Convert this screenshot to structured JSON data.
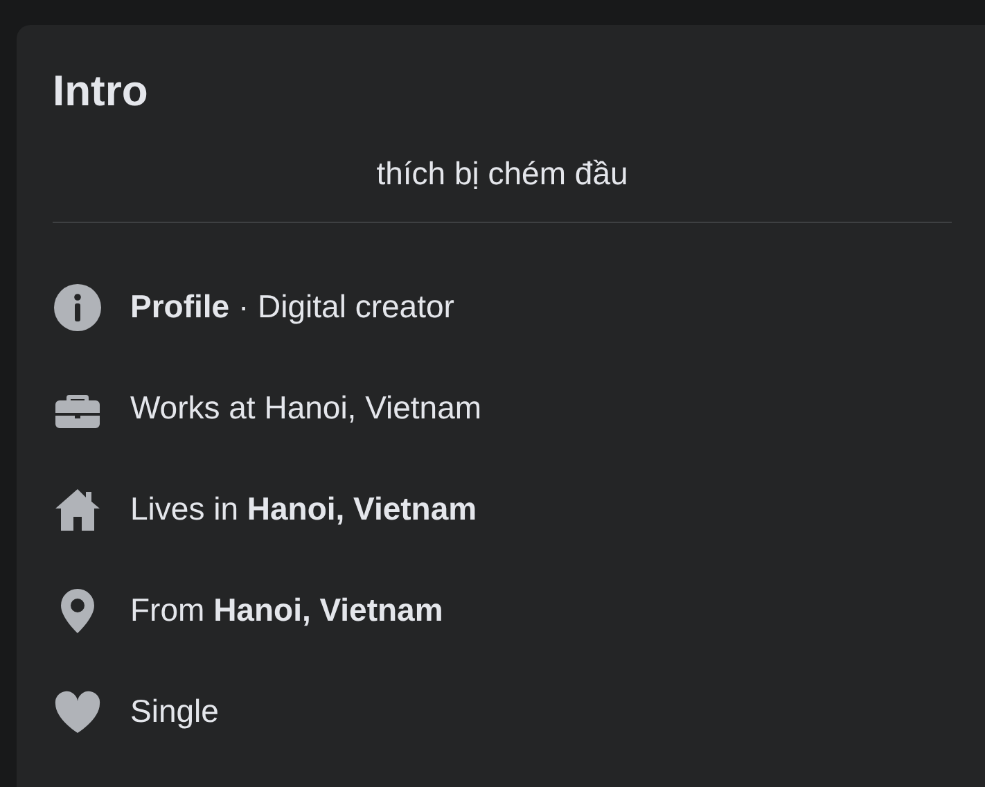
{
  "card": {
    "title": "Intro",
    "bio": "thích bị chém đầu"
  },
  "items": [
    {
      "kind": "info",
      "text": "**Profile** · Digital creator"
    },
    {
      "kind": "work",
      "text": "Works at Hanoi, Vietnam"
    },
    {
      "kind": "home",
      "text": "Lives in **Hanoi, Vietnam**"
    },
    {
      "kind": "pin",
      "text": "From **Hanoi, Vietnam**"
    },
    {
      "kind": "heart",
      "text": "Single"
    }
  ]
}
